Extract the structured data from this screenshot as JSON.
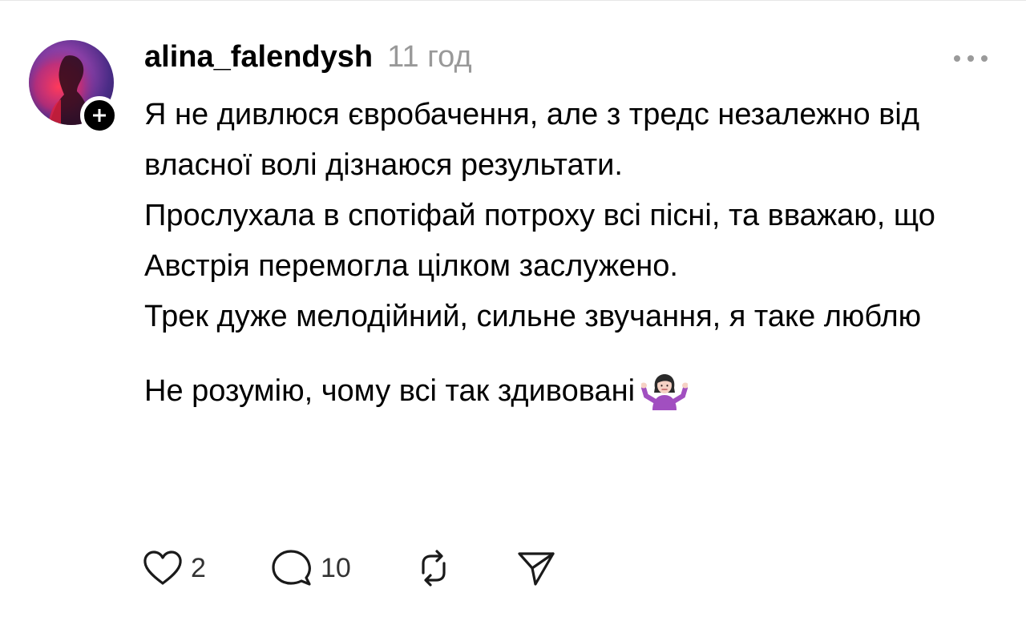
{
  "post": {
    "username": "alina_falendysh",
    "time": "11 год",
    "paragraphs": [
      "Я не дивлюся євробачення, але з тредс незалежно від власної волі дізнаюся результати.",
      "Прослухала в спотіфай потроху всі пісні, та вважаю, що Австрія перемогла цілком заслужено.",
      "Трек дуже мелодійний, сильне звучання, я таке люблю"
    ],
    "last_paragraph": "Не розумію, чому всі так здивовані",
    "emoji": "woman-shrugging-emoji"
  },
  "actions": {
    "likes": "2",
    "replies": "10"
  },
  "icons": {
    "avatar": "avatar-image",
    "follow": "plus-icon",
    "more": "more-horizontal-icon",
    "like": "heart-icon",
    "reply": "comment-icon",
    "repost": "repost-icon",
    "share": "send-icon"
  },
  "colors": {
    "text": "#000000",
    "secondary": "#999999",
    "icon": "#1a1a1a"
  }
}
